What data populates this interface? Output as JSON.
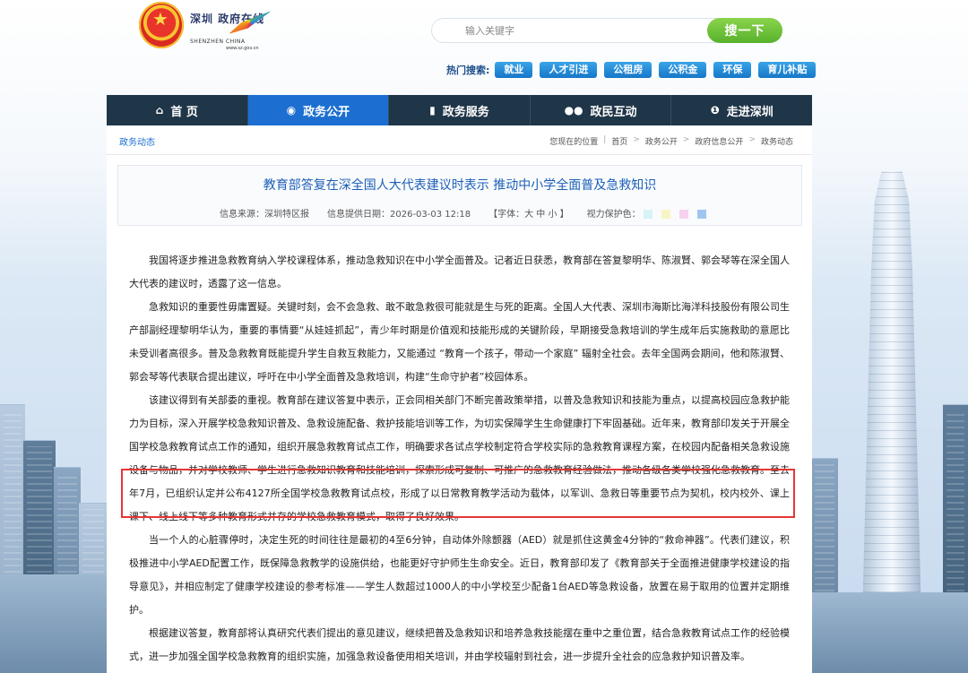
{
  "site": {
    "logo_cn": "深圳 政府在线",
    "logo_en": "SHENZHEN CHINA",
    "logo_url": "www.sz.gov.cn"
  },
  "search": {
    "placeholder": "输入关键字",
    "button_label": "搜一下"
  },
  "hot_search": {
    "label": "热门搜索:",
    "tags": [
      "就业",
      "人才引进",
      "公租房",
      "公积金",
      "环保",
      "育儿补贴"
    ]
  },
  "nav": [
    {
      "label": "首 页",
      "icon": "home-icon",
      "active": false
    },
    {
      "label": "政务公开",
      "icon": "eye-icon",
      "active": true
    },
    {
      "label": "政务服务",
      "icon": "service-icon",
      "active": false
    },
    {
      "label": "政民互动",
      "icon": "people-icon",
      "active": false
    },
    {
      "label": "走进深圳",
      "icon": "info-icon",
      "active": false
    }
  ],
  "breadcrumb": {
    "section_title": "政务动态",
    "prefix": "您现在的位置",
    "items": [
      "首页",
      "政务公开",
      "政府信息公开",
      "政务动态"
    ]
  },
  "article": {
    "title": "教育部答复在深全国人大代表建议时表示 推动中小学全面普及急救知识",
    "source": "信息来源：深圳特区报",
    "date": "信息提供日期：2026-03-03 12:18",
    "font_size": "【字体：大 中 小 】",
    "eye_protect_label": "视力保护色：",
    "swatch_colors": [
      "#d6f3f7",
      "#f8f5c4",
      "#f6d2ee",
      "#9ec6f0"
    ],
    "paragraphs": [
      "我国将逐步推进急救教育纳入学校课程体系，推动急救知识在中小学全面普及。记者近日获悉，教育部在答复黎明华、陈淑賢、郭会琴等在深全国人大代表的建议时，透露了这一信息。",
      "急救知识的重要性毋庸置疑。关键时刻，会不会急救、敢不敢急救很可能就是生与死的距离。全国人大代表、深圳市海斯比海洋科技股份有限公司生产部副经理黎明华认为，重要的事情要“从娃娃抓起”，青少年时期是价值观和技能形成的关键阶段，早期接受急救培训的学生成年后实施救助的意愿比未受训者高很多。普及急救教育既能提升学生自救互救能力，又能通过 “教育一个孩子，带动一个家庭” 辐射全社会。去年全国两会期间，他和陈淑賢、郭会琴等代表联合提出建议，呼吁在中小学全面普及急救培训，构建“生命守护者”校园体系。",
      "该建议得到有关部委的重视。教育部在建议答复中表示，正会同相关部门不断完善政策举措，以普及急救知识和技能为重点，以提高校园应急救护能力为目标，深入开展学校急救知识普及、急救设施配备、救护技能培训等工作，为切实保障学生生命健康打下牢固基础。近年来，教育部印发关于开展全国学校急救教育试点工作的通知，组织开展急救教育试点工作，明确要求各试点学校制定符合学校实际的急救教育课程方案，在校园内配备相关急救设施设备与物品，并对学校教师、学生进行急救知识教育和技能培训，探索形成可复制、可推广的急救教育经验做法，推动各级各类学校强化急救教育。至去年7月，已组织认定并公布4127所全国学校急救教育试点校，形成了以日常教育教学活动为载体，以军训、急救日等重要节点为契机，校内校外、课上课下、线上线下等多种教育形式并存的学校急救教育模式，取得了良好效果。",
      "当一个人的心脏骤停时，决定生死的时间往往是最初的4至6分钟，自动体外除颤器（AED）就是抓住这黄金4分钟的“救命神器”。代表们建议，积极推进中小学AED配置工作，既保障急救教学的设施供给，也能更好守护师生生命安全。近日，教育部印发了《教育部关于全面推进健康学校建设的指导意见》，并相应制定了健康学校建设的参考标准——学生人数超过1000人的中小学校至少配备1台AED等急救设备，放置在易于取用的位置并定期维护。",
      "根据建议答复，教育部将认真研究代表们提出的意见建议，继续把普及急救知识和培养急救技能摆在重中之重位置，结合急救教育试点工作的经验模式，进一步加强全国学校急救教育的组织实施，加强急救设备使用相关培训，并由学校辐射到社会，进一步提升全社会的应急救护知识普及率。"
    ]
  }
}
